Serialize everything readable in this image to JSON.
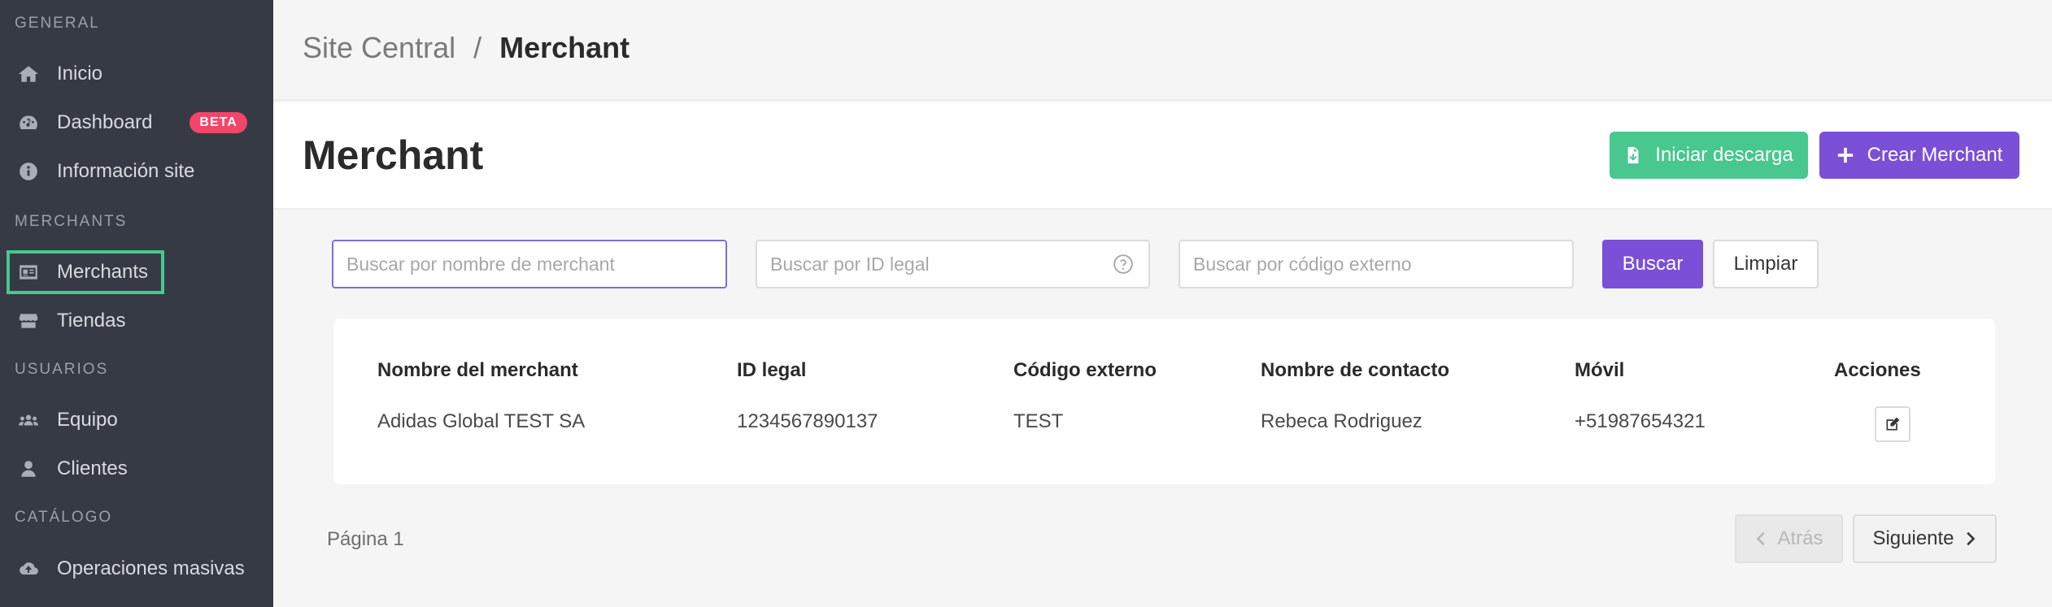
{
  "sidebar": {
    "sections": [
      {
        "label": "GENERAL"
      },
      {
        "label": "MERCHANTS"
      },
      {
        "label": "USUARIOS"
      },
      {
        "label": "CATÁLOGO"
      }
    ],
    "items": [
      {
        "label": "Inicio",
        "icon": "home-icon"
      },
      {
        "label": "Dashboard",
        "icon": "dashboard-icon",
        "badge": "BETA"
      },
      {
        "label": "Información site",
        "icon": "info-icon"
      },
      {
        "label": "Merchants",
        "icon": "id-card-icon",
        "active": true
      },
      {
        "label": "Tiendas",
        "icon": "store-icon"
      },
      {
        "label": "Equipo",
        "icon": "users-icon"
      },
      {
        "label": "Clientes",
        "icon": "user-icon"
      },
      {
        "label": "Operaciones masivas",
        "icon": "cloud-upload-icon"
      }
    ]
  },
  "breadcrumb": {
    "root": "Site Central",
    "separator": "/",
    "current": "Merchant"
  },
  "header": {
    "title": "Merchant",
    "download_label": "Iniciar descarga",
    "create_label": "Crear Merchant"
  },
  "filters": {
    "name_placeholder": "Buscar por nombre de merchant",
    "legal_id_placeholder": "Buscar por ID legal",
    "external_code_placeholder": "Buscar por código externo",
    "search_label": "Buscar",
    "clear_label": "Limpiar"
  },
  "table": {
    "columns": [
      "Nombre del merchant",
      "ID legal",
      "Código externo",
      "Nombre de contacto",
      "Móvil",
      "Acciones"
    ],
    "rows": [
      {
        "name": "Adidas Global TEST SA",
        "legal_id": "1234567890137",
        "external_code": "TEST",
        "contact": "Rebeca Rodriguez",
        "mobile": "+51987654321"
      }
    ]
  },
  "pagination": {
    "page_label": "Página 1",
    "prev_label": "Atrás",
    "next_label": "Siguiente"
  },
  "colors": {
    "sidebar_bg": "#363a44",
    "primary": "#7b4fd6",
    "success": "#48c78e",
    "danger": "#f14668"
  }
}
